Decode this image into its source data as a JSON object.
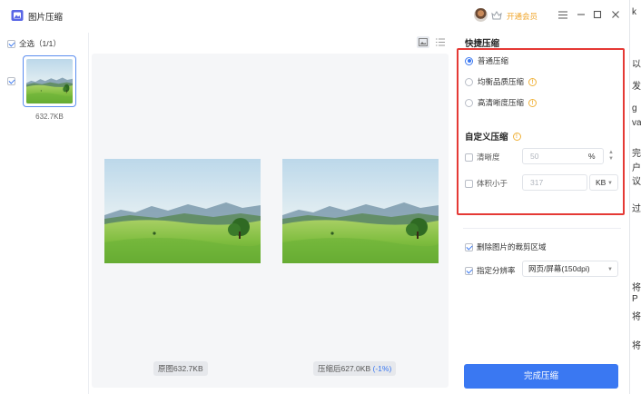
{
  "app": {
    "title": "图片压缩",
    "vip_label": "开通会员"
  },
  "list": {
    "select_all_label": "全选（1/1）",
    "items": [
      {
        "size": "632.7KB"
      }
    ]
  },
  "preview": {
    "original_caption": "原图632.7KB",
    "compressed_caption": "压缩后627.0KB",
    "compressed_change": "(-1%)"
  },
  "quick": {
    "heading": "快捷压缩",
    "options": [
      {
        "label": "普通压缩",
        "selected": true
      },
      {
        "label": "均衡品质压缩",
        "selected": false
      },
      {
        "label": "高清晰度压缩",
        "selected": false
      }
    ]
  },
  "custom": {
    "heading": "自定义压缩",
    "clarity": {
      "label": "清晰度",
      "value": "50",
      "unit": "%"
    },
    "size_limit": {
      "label": "体积小于",
      "value": "317",
      "unit": "KB"
    }
  },
  "extra": {
    "remove_crop_label": "删除图片的裁剪区域",
    "resolution_label": "指定分辨率",
    "resolution_value": "网页/屏幕(150dpi)"
  },
  "action": {
    "label": "完成压缩"
  },
  "background_chars": [
    "k",
    "以",
    "发",
    "g",
    "va",
    "完",
    "户",
    "议",
    "过",
    "将",
    "P",
    "将",
    "将"
  ],
  "colors": {
    "accent": "#3a78f2",
    "highlight_frame": "#e53935",
    "vip": "#f0a52a"
  }
}
